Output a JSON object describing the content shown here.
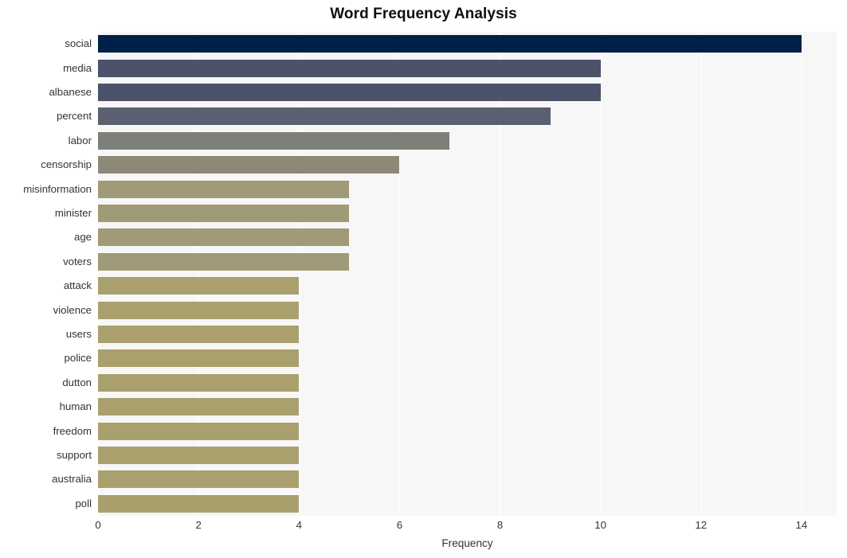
{
  "chart_data": {
    "type": "bar",
    "orientation": "horizontal",
    "title": "Word Frequency Analysis",
    "xlabel": "Frequency",
    "ylabel": "",
    "xlim": [
      0,
      14.7
    ],
    "xticks": [
      0,
      2,
      4,
      6,
      8,
      10,
      12,
      14
    ],
    "xtick_labels": [
      "0",
      "2",
      "4",
      "6",
      "8",
      "10",
      "12",
      "14"
    ],
    "grid": "vertical-white-on-gray",
    "legend": "none",
    "categories": [
      "social",
      "media",
      "albanese",
      "percent",
      "labor",
      "censorship",
      "misinformation",
      "minister",
      "age",
      "voters",
      "attack",
      "violence",
      "users",
      "police",
      "dutton",
      "human",
      "freedom",
      "support",
      "australia",
      "poll"
    ],
    "values": [
      14,
      10,
      10,
      9,
      7,
      6,
      5,
      5,
      5,
      5,
      4,
      4,
      4,
      4,
      4,
      4,
      4,
      4,
      4,
      4
    ],
    "bar_colors": [
      "#002147",
      "#4b5269",
      "#4b5269",
      "#5b6070",
      "#7f7f7a",
      "#8e8878",
      "#a09a78",
      "#a09a78",
      "#a09a78",
      "#a09a78",
      "#aaa06e",
      "#aaa06e",
      "#aaa06e",
      "#aaa06e",
      "#aaa06e",
      "#aaa06e",
      "#aaa06e",
      "#aaa06e",
      "#aaa06e",
      "#aaa06e"
    ],
    "plot_background": "#f7f7f7",
    "figure_background": "#ffffff",
    "gridline_color": "#ffffff"
  }
}
